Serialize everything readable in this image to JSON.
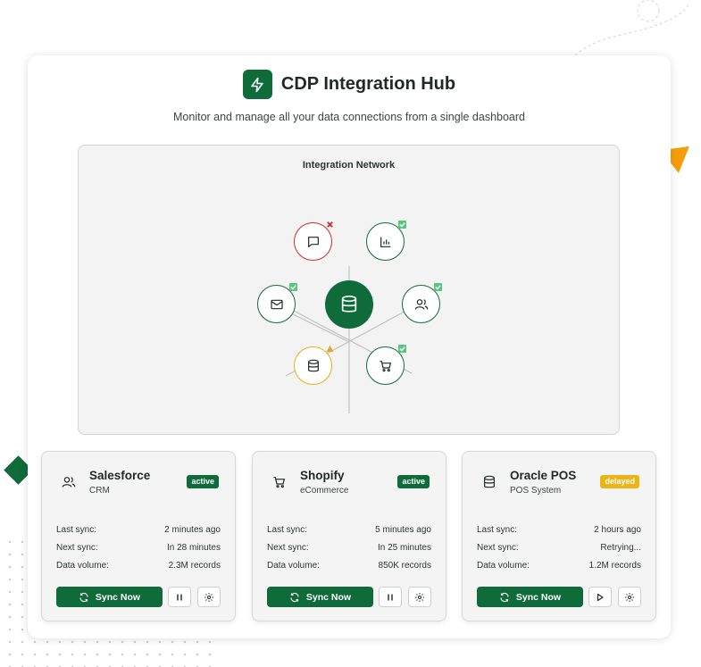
{
  "app": {
    "title": "CDP Integration Hub",
    "subtitle": "Monitor and manage all your data connections from a single dashboard",
    "logo_icon": "lightning-icon"
  },
  "colors": {
    "primary": "#0f6b3a",
    "error": "#d12a2a",
    "warning": "#e6b10e",
    "delayed_badge": "#ecb415",
    "accent_triangle": "#f59e0b"
  },
  "network": {
    "title": "Integration Network",
    "hub_icon": "database-icon",
    "nodes": [
      {
        "icon": "chat-icon",
        "status": "error"
      },
      {
        "icon": "bar-chart-icon",
        "status": "ok"
      },
      {
        "icon": "mail-icon",
        "status": "ok"
      },
      {
        "icon": "users-icon",
        "status": "ok"
      },
      {
        "icon": "database-icon",
        "status": "warning"
      },
      {
        "icon": "cart-icon",
        "status": "ok"
      }
    ]
  },
  "integrations": [
    {
      "name": "Salesforce",
      "type": "CRM",
      "icon": "users-icon",
      "status": "active",
      "last_sync_label": "Last sync:",
      "last_sync": "2 minutes ago",
      "next_sync_label": "Next sync:",
      "next_sync": "In 28 minutes",
      "volume_label": "Data volume:",
      "volume": "2.3M records",
      "sync_label": "Sync Now",
      "toggle_icon": "pause-icon"
    },
    {
      "name": "Shopify",
      "type": "eCommerce",
      "icon": "cart-icon",
      "status": "active",
      "last_sync_label": "Last sync:",
      "last_sync": "5 minutes ago",
      "next_sync_label": "Next sync:",
      "next_sync": "In 25 minutes",
      "volume_label": "Data volume:",
      "volume": "850K records",
      "sync_label": "Sync Now",
      "toggle_icon": "pause-icon"
    },
    {
      "name": "Oracle POS",
      "type": "POS System",
      "icon": "database-icon",
      "status": "delayed",
      "last_sync_label": "Last sync:",
      "last_sync": "2 hours ago",
      "next_sync_label": "Next sync:",
      "next_sync": "Retrying...",
      "volume_label": "Data volume:",
      "volume": "1.2M records",
      "sync_label": "Sync Now",
      "toggle_icon": "play-icon"
    }
  ]
}
